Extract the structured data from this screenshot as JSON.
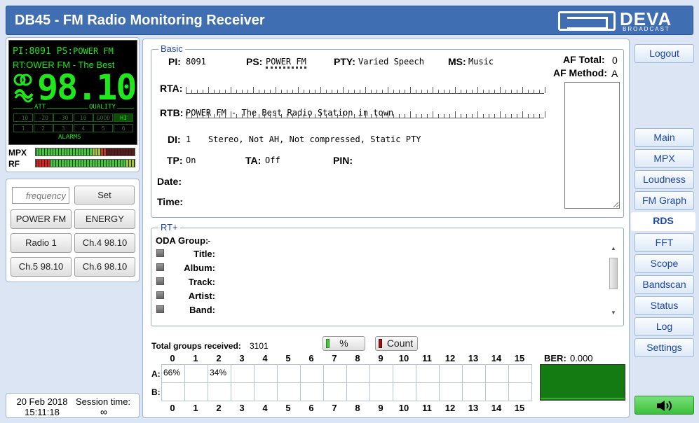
{
  "header": {
    "title": "DB45 - FM Radio Monitoring Receiver",
    "logo_text": "DEVA",
    "logo_sub": "BROADCAST"
  },
  "display": {
    "pi_label": "PI:",
    "pi": "8091",
    "ps_label": "PS:",
    "ps": "POWER FM",
    "rt_label": "RT:",
    "rt": "OWER FM - The Best",
    "frequency": "98.10",
    "att_label": "ATT",
    "quality_label": "QUALITY",
    "alarms_label": "ALARMS",
    "att_cells": [
      "-10",
      "-20",
      "-30",
      "10"
    ],
    "quality_cells": [
      "GOOD",
      "HI"
    ],
    "alarm_cells": [
      "1",
      "2",
      "3",
      "4",
      "5",
      "6"
    ],
    "mpx_label": "MPX",
    "rf_label": "RF",
    "mpx_level": 0.7,
    "rf_level": 0.2
  },
  "presets": {
    "frequency_placeholder": "frequency",
    "set_label": "Set",
    "buttons": [
      "POWER FM",
      "ENERGY",
      "Radio 1",
      "Ch.4 98.10",
      "Ch.5 98.10",
      "Ch.6 98.10"
    ]
  },
  "footer": {
    "date": "20 Feb 2018",
    "time": "15:11:18",
    "session_label": "Session time:",
    "session_value": "∞"
  },
  "basic": {
    "legend": "Basic",
    "pi_label": "PI:",
    "pi": "8091",
    "ps_label": "PS:",
    "ps": "POWER FM",
    "pty_label": "PTY:",
    "pty": "Varied Speech",
    "ms_label": "MS:",
    "ms": "Music",
    "af_total_label": "AF Total:",
    "af_total": "0",
    "af_method_label": "AF Method:",
    "af_method": "A",
    "rta_label": "RTA:",
    "rtb_label": "RTB:",
    "rtb": "POWER FM - The Best Radio Station in town",
    "di_label": "DI:",
    "di": "1",
    "di_text": "Stereo, Not AH, Not compressed, Static PTY",
    "tp_label": "TP:",
    "tp": "On",
    "ta_label": "TA:",
    "ta": "Off",
    "pin_label": "PIN:",
    "date_label": "Date:",
    "time_label": "Time:"
  },
  "rtplus": {
    "legend": "RT+",
    "oda_label": "ODA Group:",
    "oda": "-",
    "fields": [
      "Title:",
      "Album:",
      "Track:",
      "Artist:",
      "Band:"
    ]
  },
  "groups": {
    "total_label": "Total groups received:",
    "total": "3101",
    "percent_label": "%",
    "count_label": "Count",
    "columns": [
      "0",
      "1",
      "2",
      "3",
      "4",
      "5",
      "6",
      "7",
      "8",
      "9",
      "10",
      "11",
      "12",
      "13",
      "14",
      "15"
    ],
    "row_a_label": "A:",
    "row_b_label": "B:",
    "row_a": [
      "66%",
      "",
      "34%",
      "",
      "",
      "",
      "",
      "",
      "",
      "",
      "",
      "",
      "",
      "",
      "",
      ""
    ],
    "row_b": [
      "",
      "",
      "",
      "",
      "",
      "",
      "",
      "",
      "",
      "",
      "",
      "",
      "",
      "",
      "",
      ""
    ],
    "ber_label": "BER:",
    "ber": "0.000"
  },
  "nav": {
    "logout": "Logout",
    "items": [
      "Main",
      "MPX",
      "Loudness",
      "FM Graph",
      "RDS",
      "FFT",
      "Scope",
      "Bandscan",
      "Status",
      "Log",
      "Settings"
    ],
    "active": "RDS"
  },
  "colors": {
    "header": "#3f6eb3",
    "lcd_green": "#20e61c",
    "accent": "#1c45a8"
  }
}
